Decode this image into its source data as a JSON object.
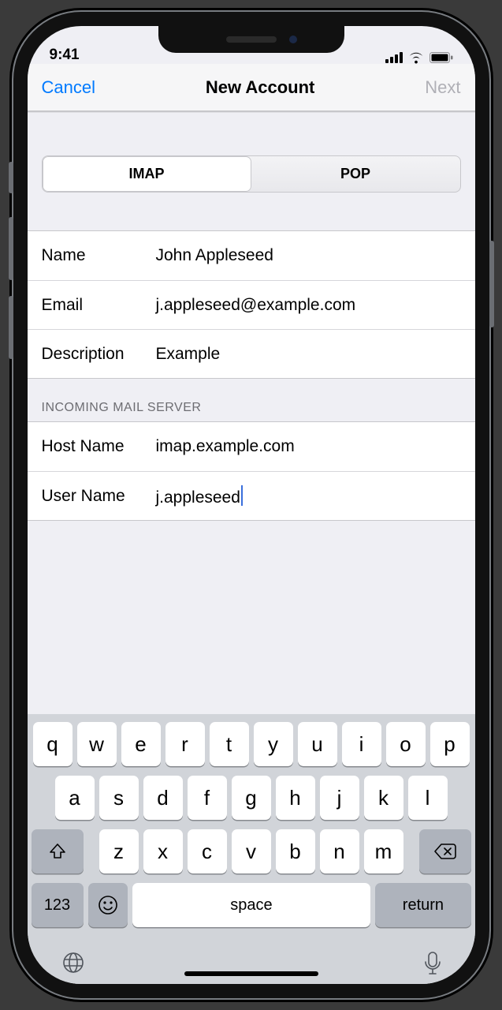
{
  "statusbar": {
    "time": "9:41"
  },
  "nav": {
    "cancel": "Cancel",
    "title": "New Account",
    "next": "Next"
  },
  "segment": {
    "imap": "IMAP",
    "pop": "POP"
  },
  "account": {
    "name_label": "Name",
    "name_value": "John Appleseed",
    "email_label": "Email",
    "email_value": "j.appleseed@example.com",
    "desc_label": "Description",
    "desc_value": "Example"
  },
  "incoming": {
    "header": "INCOMING MAIL SERVER",
    "host_label": "Host Name",
    "host_value": "imap.example.com",
    "user_label": "User Name",
    "user_value": "j.appleseed"
  },
  "keyboard": {
    "row1": [
      "q",
      "w",
      "e",
      "r",
      "t",
      "y",
      "u",
      "i",
      "o",
      "p"
    ],
    "row2": [
      "a",
      "s",
      "d",
      "f",
      "g",
      "h",
      "j",
      "k",
      "l"
    ],
    "row3_keys": [
      "z",
      "x",
      "c",
      "v",
      "b",
      "n",
      "m"
    ],
    "num": "123",
    "space": "space",
    "return": "return"
  }
}
